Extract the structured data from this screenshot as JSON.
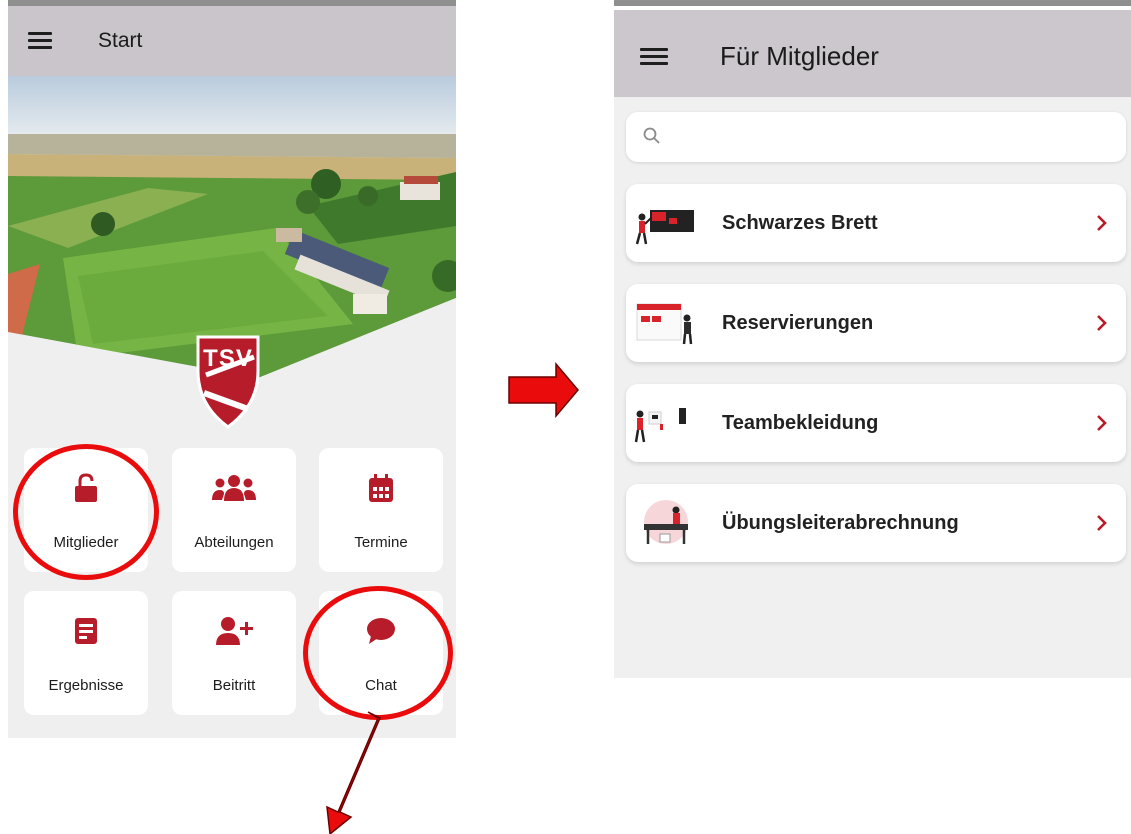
{
  "colors": {
    "brand_red": "#b71c2a",
    "annotation_red": "#ea0c0c",
    "appbar_grey": "#c9c5ca"
  },
  "left_screen": {
    "app_bar": {
      "title": "Start",
      "icon": "menu-icon"
    },
    "club_logo": {
      "text": "TSV"
    },
    "tiles": [
      {
        "label": "Mitglieder",
        "icon": "lock-open-icon",
        "highlighted": true
      },
      {
        "label": "Abteilungen",
        "icon": "users-icon",
        "highlighted": false
      },
      {
        "label": "Termine",
        "icon": "calendar-icon",
        "highlighted": false
      },
      {
        "label": "Ergebnisse",
        "icon": "document-icon",
        "highlighted": false
      },
      {
        "label": "Beitritt",
        "icon": "add-user-icon",
        "highlighted": false
      },
      {
        "label": "Chat",
        "icon": "chat-icon",
        "highlighted": true
      }
    ]
  },
  "right_screen": {
    "app_bar": {
      "title": "Für Mitglieder",
      "icon": "menu-icon"
    },
    "search": {
      "icon": "search-icon",
      "placeholder": ""
    },
    "menu_items": [
      {
        "label": "Schwarzes Brett",
        "icon": "bulletin-board-illustration"
      },
      {
        "label": "Reservierungen",
        "icon": "reservation-illustration"
      },
      {
        "label": "Teambekleidung",
        "icon": "team-clothing-illustration"
      },
      {
        "label": "Übungsleiterabrechnung",
        "icon": "trainer-billing-illustration"
      }
    ]
  }
}
